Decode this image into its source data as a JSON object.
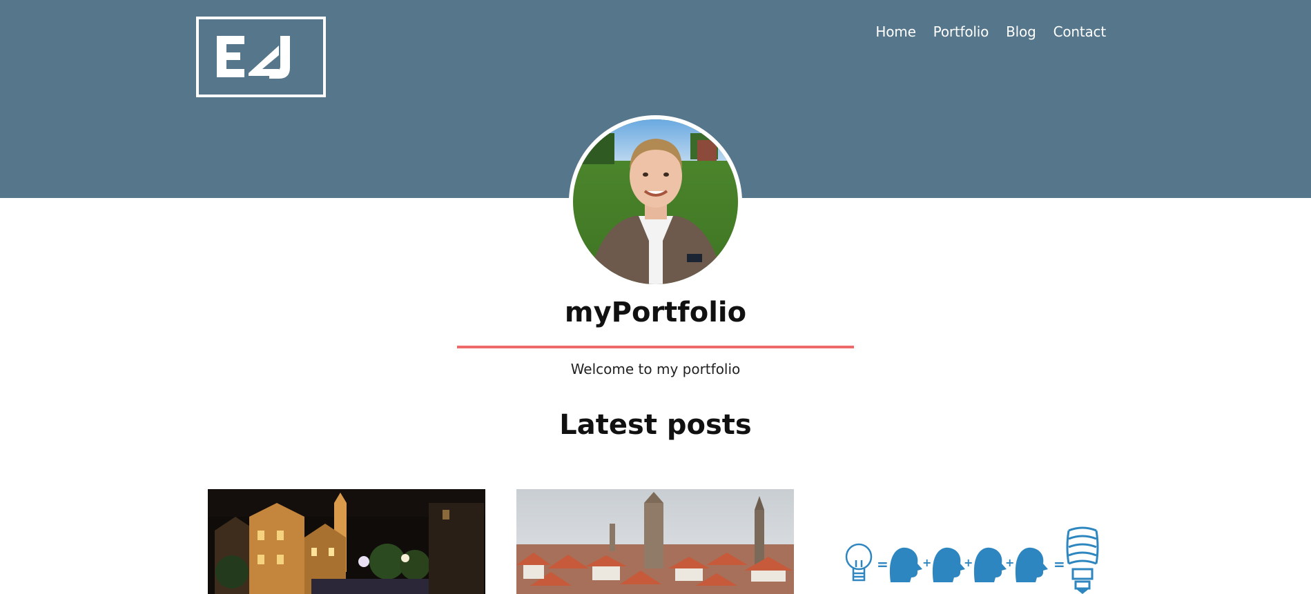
{
  "header": {
    "logo_text": "EAJ",
    "brand_color": "#56768b"
  },
  "nav": {
    "items": [
      {
        "label": "Home"
      },
      {
        "label": "Portfolio"
      },
      {
        "label": "Blog"
      },
      {
        "label": "Contact"
      }
    ]
  },
  "hero": {
    "title": "myPortfolio",
    "subtitle": "Welcome to my portfolio",
    "accent_color": "#ee6a6a"
  },
  "posts_section": {
    "title": "Latest posts",
    "posts": [
      {
        "image": "night-canal-city-photo"
      },
      {
        "image": "city-rooftops-towers-photo"
      },
      {
        "image": "idea-teamwork-infographic"
      }
    ]
  }
}
